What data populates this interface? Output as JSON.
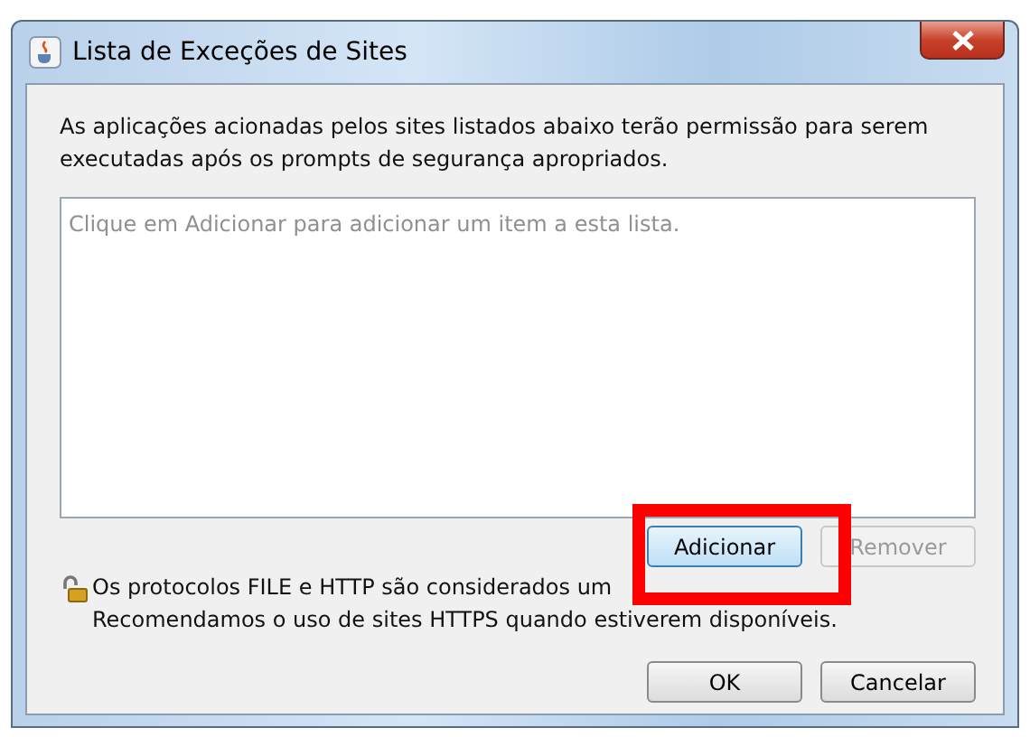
{
  "window": {
    "title": "Lista de Exceções de Sites"
  },
  "description": "As aplicações acionadas pelos sites listados abaixo terão permissão para serem executadas após os prompts de segurança apropriados.",
  "site_list": {
    "placeholder": "Clique em Adicionar para adicionar um item a esta lista."
  },
  "list_buttons": [
    {
      "label": "Adicionar",
      "disabled": false
    },
    {
      "label": "Remover",
      "disabled": true
    }
  ],
  "notice": {
    "lines": [
      "Os protocolos FILE e HTTP são considerados um",
      "Recomendamos o uso de sites HTTPS quando estiverem disponíveis."
    ]
  },
  "buttons": [
    "OK",
    "Cancelar"
  ]
}
